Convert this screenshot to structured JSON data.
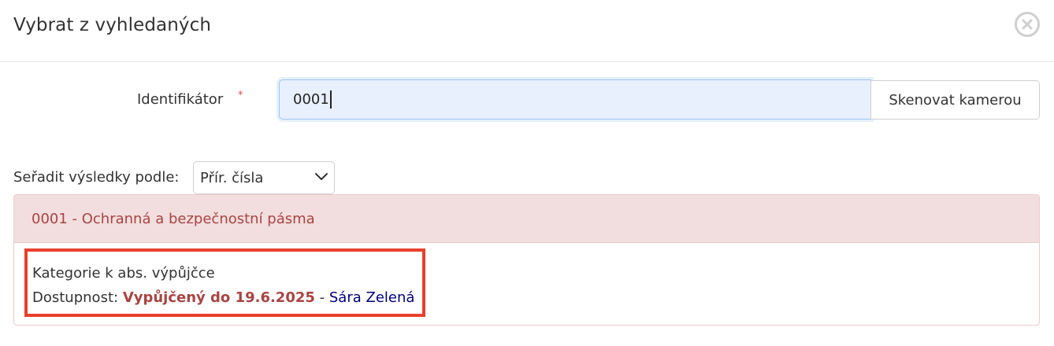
{
  "modal": {
    "title": "Vybrat z vyhledaných",
    "close_icon": "close-circle-icon"
  },
  "form": {
    "identifier_label": "Identifikátor",
    "required_mark": "*",
    "identifier_value": "0001",
    "scan_button_label": "Skenovat kamerou"
  },
  "sort": {
    "label": "Seřadit výsledky podle:",
    "selected": "Přír. čísla",
    "chevron_icon": "chevron-down-icon"
  },
  "result": {
    "heading": "0001 - Ochranná a bezpečnostní pásma",
    "category": "Kategorie k abs. výpůjčce",
    "availability_label": "Dostupnost:",
    "availability_status": "Vypůjčený do 19.6.2025",
    "separator": "-",
    "borrower": "Sára Zelená"
  },
  "colors": {
    "panel_bg": "#f2dede",
    "panel_text": "#a94442",
    "highlight_border": "#e8402a",
    "link": "#000080",
    "input_bg": "#e8f0fe"
  }
}
